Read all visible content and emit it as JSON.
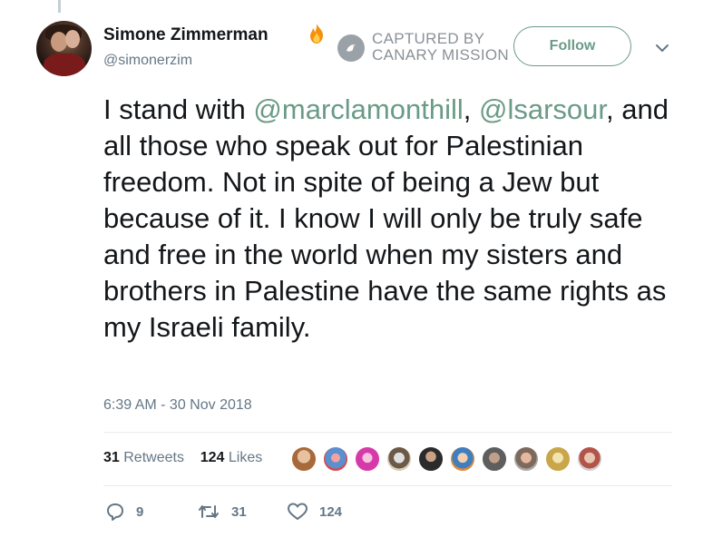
{
  "user": {
    "display_name": "Simone Zimmerman",
    "handle": "@simonerzim",
    "badge_icon": "fire-icon"
  },
  "watermark": {
    "line1": "CAPTURED BY",
    "line2": "CANARY MISSION"
  },
  "follow_label": "Follow",
  "tweet": {
    "part1": "I stand with ",
    "mention1": "@marclamonthill",
    "part2": ", ",
    "mention2": "@lsarsour",
    "part3": ", and all those who speak out for Palestinian freedom. Not in spite of being a Jew but because of it. I know I will only be truly safe and free in the world when my sisters and brothers in Palestine have the same rights as my Israeli family."
  },
  "timestamp": "6:39 AM - 30 Nov 2018",
  "stats": {
    "retweets_count": "31",
    "retweets_label": "Retweets",
    "likes_count": "124",
    "likes_label": "Likes"
  },
  "liker_avatars_count": 10,
  "actions": {
    "reply_count": "9",
    "retweet_count": "31",
    "like_count": "124"
  },
  "colors": {
    "accent": "#6a9b87",
    "text": "#14171a",
    "muted": "#657786"
  }
}
